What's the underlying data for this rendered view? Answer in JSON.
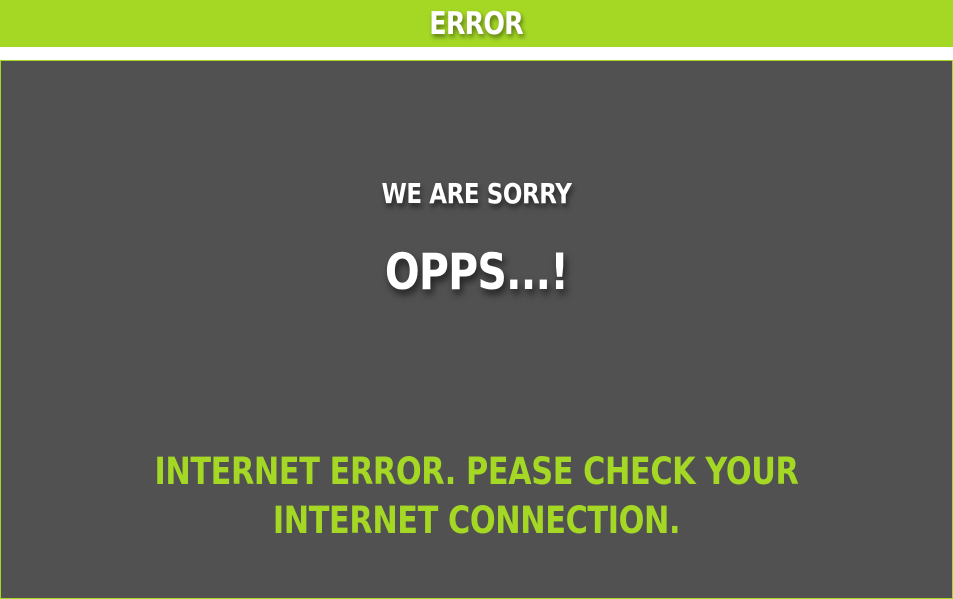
{
  "header": {
    "title": "ERROR"
  },
  "panel": {
    "subtitle": "WE ARE SORRY",
    "headline": "OPPS...!",
    "message_lines": [
      "INTERNET ERROR. PEASE CHECK YOUR",
      "INTERNET CONNECTION."
    ]
  },
  "colors": {
    "accent": "#a4d824",
    "panel_bg": "#515151",
    "text": "#ffffff"
  }
}
